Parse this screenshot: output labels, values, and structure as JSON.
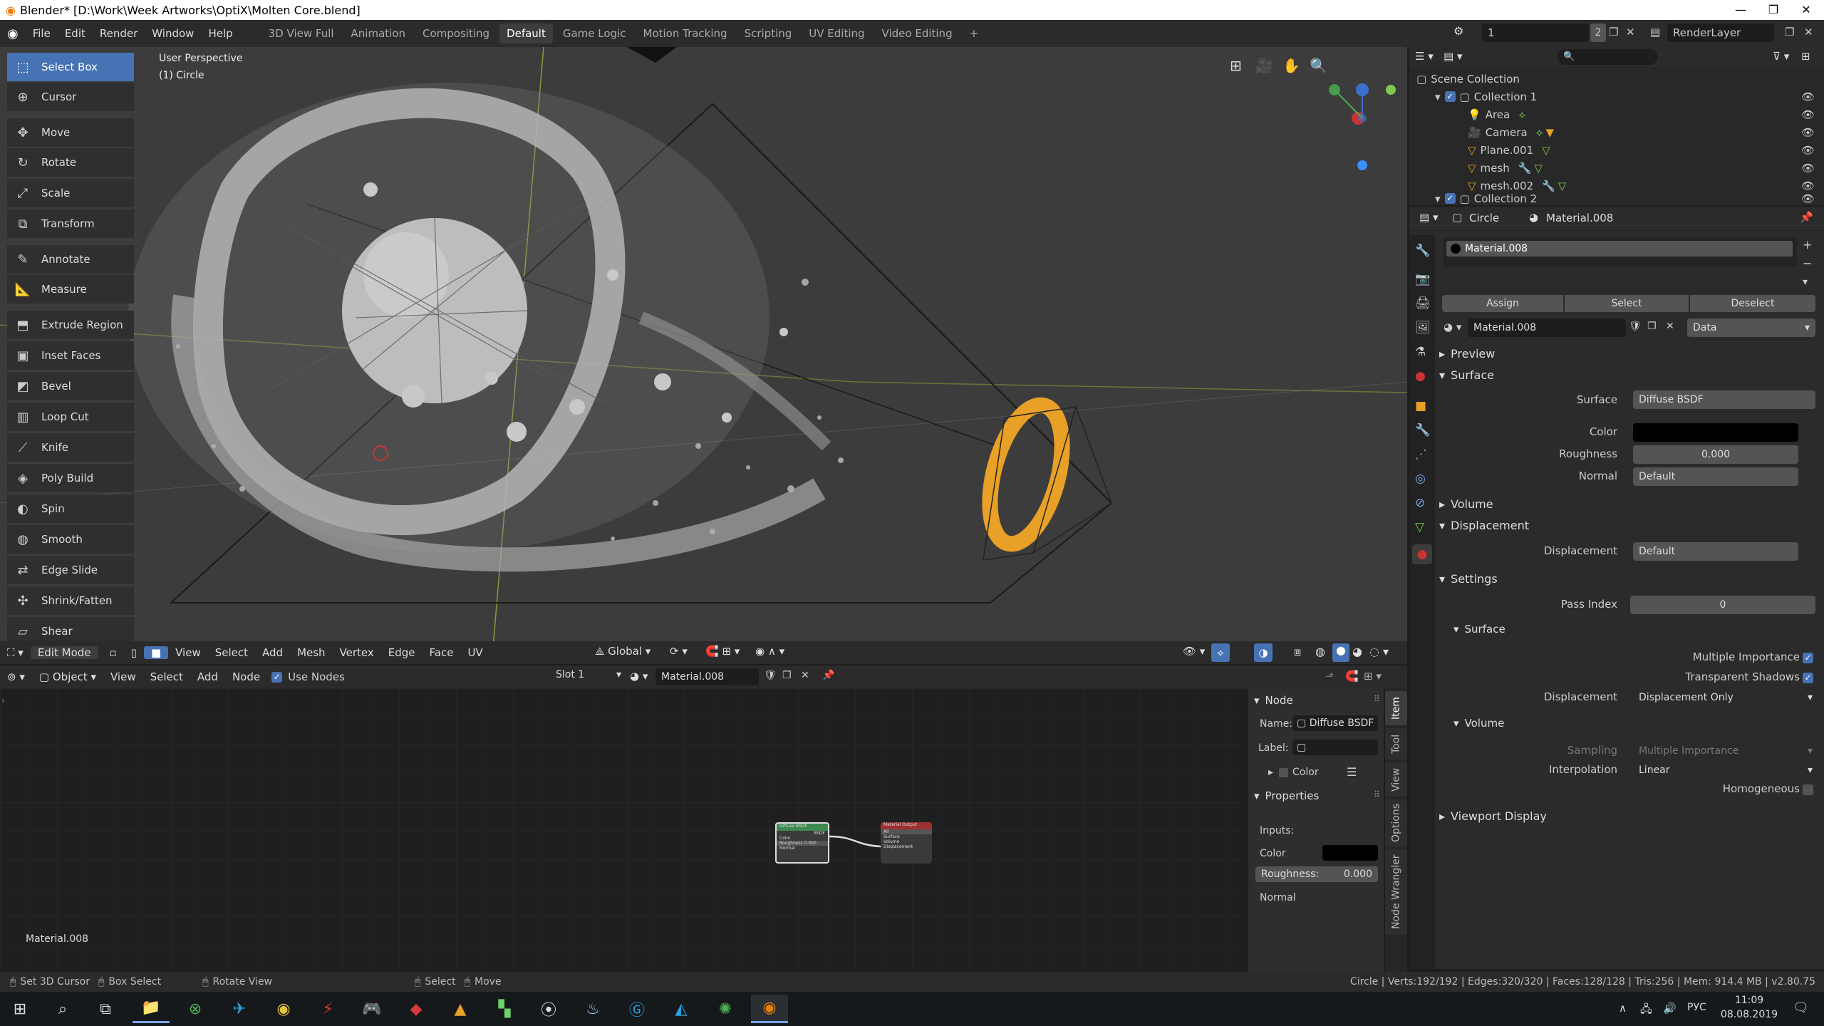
{
  "window": {
    "title": "Blender* [D:\\Work\\Week Artworks\\OptiX\\Molten Core.blend]",
    "controls": [
      "—",
      "❐",
      "✕"
    ]
  },
  "menu": {
    "items": [
      "File",
      "Edit",
      "Render",
      "Window",
      "Help"
    ],
    "workspaces": [
      "3D View Full",
      "Animation",
      "Compositing",
      "Default",
      "Game Logic",
      "Motion Tracking",
      "Scripting",
      "UV Editing",
      "Video Editing"
    ],
    "active_workspace": "Default",
    "add_tab": "+",
    "scene_name": "1",
    "scene_count": "2",
    "render_layer": "RenderLayer"
  },
  "viewport": {
    "perspective": "User Perspective",
    "object_label": "(1) Circle",
    "tools": [
      "Select Box",
      "Cursor",
      "Move",
      "Rotate",
      "Scale",
      "Transform",
      "Annotate",
      "Measure",
      "Extrude Region",
      "Inset Faces",
      "Bevel",
      "Loop Cut",
      "Knife",
      "Poly Build",
      "Spin",
      "Smooth",
      "Edge Slide",
      "Shrink/Fatten",
      "Shear"
    ],
    "active_tool": "Select Box",
    "header": {
      "mode": "Edit Mode",
      "menus": [
        "View",
        "Select",
        "Add",
        "Mesh",
        "Vertex",
        "Edge",
        "Face",
        "UV"
      ],
      "transform": "Global"
    }
  },
  "outliner": {
    "scene_collection": "Scene Collection",
    "rows": [
      {
        "label": "Collection 1"
      },
      {
        "label": "Area"
      },
      {
        "label": "Camera"
      },
      {
        "label": "Plane.001"
      },
      {
        "label": "mesh"
      },
      {
        "label": "mesh.002"
      },
      {
        "label": "Collection 2"
      }
    ]
  },
  "properties": {
    "object": "Circle",
    "material": "Material.008",
    "slot_item": "Material.008",
    "buttons": [
      "Assign",
      "Select",
      "Deselect"
    ],
    "material_field": "Material.008",
    "link": "Data",
    "sections": {
      "preview": "Preview",
      "surface": "Surface",
      "volume": "Volume",
      "displacement": "Displacement",
      "settings": "Settings",
      "viewport_display": "Viewport Display"
    },
    "surface_fields": {
      "surface_label": "Surface",
      "surface_value": "Diffuse BSDF",
      "color_label": "Color",
      "color_value": "#000000",
      "roughness_label": "Roughness",
      "roughness_value": "0.000",
      "normal_label": "Normal",
      "normal_value": "Default"
    },
    "displacement_fields": {
      "label": "Displacement",
      "value": "Default"
    },
    "settings_fields": {
      "pass_index_label": "Pass Index",
      "pass_index_value": "0",
      "surface_sub": "Surface",
      "multiple_importance": "Multiple Importance",
      "transparent_shadows": "Transparent Shadows",
      "displacement_label": "Displacement",
      "displacement_value": "Displacement Only",
      "volume_sub": "Volume",
      "sampling_label": "Sampling",
      "sampling_value": "Multiple Importance",
      "interpolation_label": "Interpolation",
      "interpolation_value": "Linear",
      "homogeneous": "Homogeneous"
    }
  },
  "node_editor": {
    "header": {
      "editor_type": "Object",
      "menus": [
        "View",
        "Select",
        "Add",
        "Node"
      ],
      "use_nodes": "Use Nodes",
      "slot": "Slot 1",
      "material": "Material.008"
    },
    "material_label": "Material.008",
    "nodes": {
      "diffuse_title": "Diffuse BSDF",
      "diffuse_out": "BSDF",
      "diffuse_inputs": [
        "Color",
        "Roughness 0.000",
        "Normal"
      ],
      "output_title": "Material Output",
      "output_target": "All",
      "output_inputs": [
        "Surface",
        "Volume",
        "Displacement"
      ]
    },
    "panel": {
      "node_header": "Node",
      "name_label": "Name:",
      "name_value": "Diffuse BSDF",
      "label_label": "Label:",
      "color_sub": "Color",
      "properties_header": "Properties",
      "inputs_label": "Inputs:",
      "color_label": "Color",
      "roughness_label": "Roughness:",
      "roughness_value": "0.000",
      "normal_label": "Normal"
    },
    "tabs": [
      "Item",
      "Tool",
      "View",
      "Options",
      "Node Wrangler"
    ]
  },
  "statusbar": {
    "left": [
      "Set 3D Cursor",
      "Box Select",
      "Rotate View",
      "Select",
      "Move"
    ],
    "right": "Circle | Verts:192/192 | Edges:320/320 | Faces:128/128 | Tris:256 | Mem: 914.4 MB | v2.80.75"
  },
  "taskbar": {
    "time": "11:09",
    "date": "08.08.2019",
    "lang": "РУС"
  },
  "colors": {
    "accent": "#4772b3",
    "ring": "#e8a026"
  }
}
